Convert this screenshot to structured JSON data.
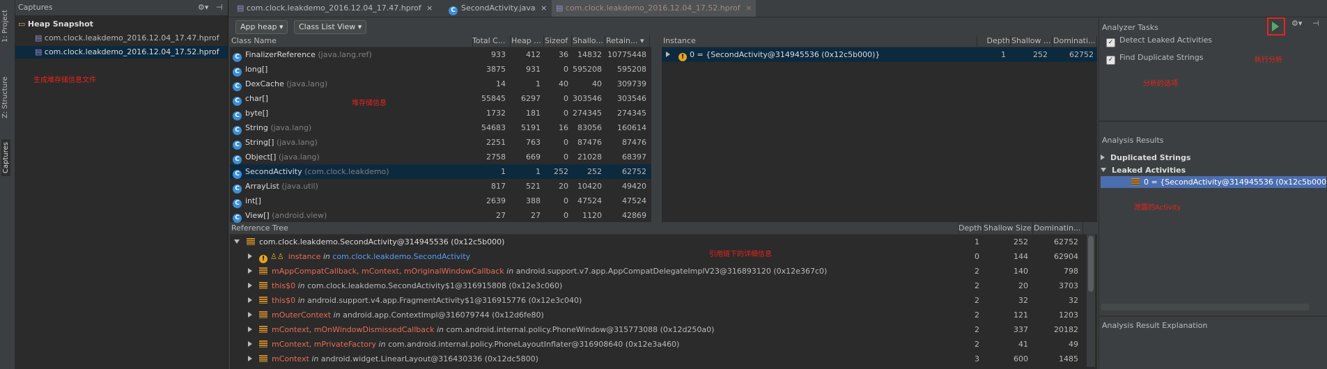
{
  "left_strip": {
    "tabs": [
      "1: Project",
      "Z: Structure",
      "Captures"
    ]
  },
  "captures": {
    "header": "Captures",
    "group": "Heap Snapshot",
    "files": [
      "com.clock.leakdemo_2016.12.04_17.47.hprof",
      "com.clock.leakdemo_2016.12.04_17.52.hprof"
    ],
    "note": "生成堆存储信息文件"
  },
  "tabs": [
    {
      "label": "com.clock.leakdemo_2016.12.04_17.47.hprof"
    },
    {
      "label": "SecondActivity.java"
    },
    {
      "label": "com.clock.leakdemo_2016.12.04_17.52.hprof"
    }
  ],
  "toolbar": {
    "heap_select": "App heap",
    "view_select": "Class List View"
  },
  "class_table": {
    "headers": [
      "Class Name",
      "Total C...",
      "Heap ...",
      "Sizeof",
      "Shallo...",
      "Retain..."
    ],
    "note": "堆存储信息",
    "rows": [
      {
        "name": "FinalizerReference",
        "pkg": "(java.lang.ref)",
        "total": "933",
        "heap": "412",
        "sizeof": "36",
        "shallow": "14832",
        "retained": "10775448"
      },
      {
        "name": "long[]",
        "pkg": "",
        "total": "3875",
        "heap": "931",
        "sizeof": "0",
        "shallow": "595208",
        "retained": "595208"
      },
      {
        "name": "DexCache",
        "pkg": "(java.lang)",
        "total": "14",
        "heap": "1",
        "sizeof": "40",
        "shallow": "40",
        "retained": "309739"
      },
      {
        "name": "char[]",
        "pkg": "",
        "total": "55845",
        "heap": "6297",
        "sizeof": "0",
        "shallow": "303546",
        "retained": "303546"
      },
      {
        "name": "byte[]",
        "pkg": "",
        "total": "1732",
        "heap": "181",
        "sizeof": "0",
        "shallow": "274345",
        "retained": "274345"
      },
      {
        "name": "String",
        "pkg": "(java.lang)",
        "total": "54683",
        "heap": "5191",
        "sizeof": "16",
        "shallow": "83056",
        "retained": "160614"
      },
      {
        "name": "String[]",
        "pkg": "(java.lang)",
        "total": "2251",
        "heap": "763",
        "sizeof": "0",
        "shallow": "87476",
        "retained": "87476"
      },
      {
        "name": "Object[]",
        "pkg": "(java.lang)",
        "total": "2758",
        "heap": "669",
        "sizeof": "0",
        "shallow": "21028",
        "retained": "68397"
      },
      {
        "name": "SecondActivity",
        "pkg": "(com.clock.leakdemo)",
        "total": "1",
        "heap": "1",
        "sizeof": "252",
        "shallow": "252",
        "retained": "62752"
      },
      {
        "name": "ArrayList",
        "pkg": "(java.util)",
        "total": "817",
        "heap": "521",
        "sizeof": "20",
        "shallow": "10420",
        "retained": "49420"
      },
      {
        "name": "int[]",
        "pkg": "",
        "total": "2639",
        "heap": "388",
        "sizeof": "0",
        "shallow": "47524",
        "retained": "47524"
      },
      {
        "name": "View[]",
        "pkg": "(android.view)",
        "total": "27",
        "heap": "27",
        "sizeof": "0",
        "shallow": "1120",
        "retained": "42869"
      }
    ]
  },
  "instance_table": {
    "headers": [
      "Instance",
      "Depth",
      "Shallow ...",
      "Dominati..."
    ],
    "rows": [
      {
        "label": "0 = {SecondActivity@314945536 (0x12c5b000)}",
        "depth": "1",
        "shallow": "252",
        "dominating": "62752"
      }
    ]
  },
  "reference_tree": {
    "headers": [
      "Reference Tree",
      "Depth",
      "Shallow Size",
      "Dominatin..."
    ],
    "note": "引用链下的详细信息",
    "root": {
      "label": "com.clock.leakdemo.SecondActivity@314945536 (0x12c5b000)",
      "depth": "1",
      "shallow": "252",
      "dominating": "62752"
    },
    "rows": [
      {
        "field": "instance",
        "in": "in",
        "target": "com.clock.leakdemo.SecondActivity",
        "depth": "0",
        "shallow": "144",
        "dominating": "62904"
      },
      {
        "field": "mAppCompatCallback, mContext, mOriginalWindowCallback",
        "in": "in",
        "target": "android.support.v7.app.AppCompatDelegateImplV23@316893120 (0x12e367c0)",
        "depth": "2",
        "shallow": "140",
        "dominating": "798"
      },
      {
        "field": "this$0",
        "in": "in",
        "target": "com.clock.leakdemo.SecondActivity$1@316915808 (0x12e3c060)",
        "depth": "2",
        "shallow": "20",
        "dominating": "3703"
      },
      {
        "field": "this$0",
        "in": "in",
        "target": "android.support.v4.app.FragmentActivity$1@316915776 (0x12e3c040)",
        "depth": "2",
        "shallow": "32",
        "dominating": "32"
      },
      {
        "field": "mOuterContext",
        "in": "in",
        "target": "android.app.ContextImpl@316079744 (0x12d6fe80)",
        "depth": "2",
        "shallow": "121",
        "dominating": "1203"
      },
      {
        "field": "mContext, mOnWindowDismissedCallback",
        "in": "in",
        "target": "com.android.internal.policy.PhoneWindow@315773088 (0x12d250a0)",
        "depth": "2",
        "shallow": "337",
        "dominating": "20182"
      },
      {
        "field": "mContext, mPrivateFactory",
        "in": "in",
        "target": "com.android.internal.policy.PhoneLayoutInflater@316908640 (0x12e3a460)",
        "depth": "2",
        "shallow": "41",
        "dominating": "49"
      },
      {
        "field": "mContext",
        "in": "in",
        "target": "android.widget.LinearLayout@316430336 (0x12dc5800)",
        "depth": "3",
        "shallow": "600",
        "dominating": "1485"
      }
    ]
  },
  "analyzer": {
    "title": "Analyzer Tasks",
    "run_note": "执行分析",
    "tasks": [
      "Detect Leaked Activities",
      "Find Duplicate Strings"
    ],
    "tasks_note": "分析的选项",
    "results_title": "Analysis Results",
    "results": [
      "Duplicated Strings",
      "Leaked Activities"
    ],
    "leaked_item": "0 = {SecondActivity@314945536 (0x12c5b000)}",
    "leaked_note": "泄露的Activity",
    "explanation_title": "Analysis Result Explanation"
  },
  "colors": {
    "accent": "#4b6eaf",
    "run": "#59a869",
    "highlight_box": "#e8241c"
  }
}
